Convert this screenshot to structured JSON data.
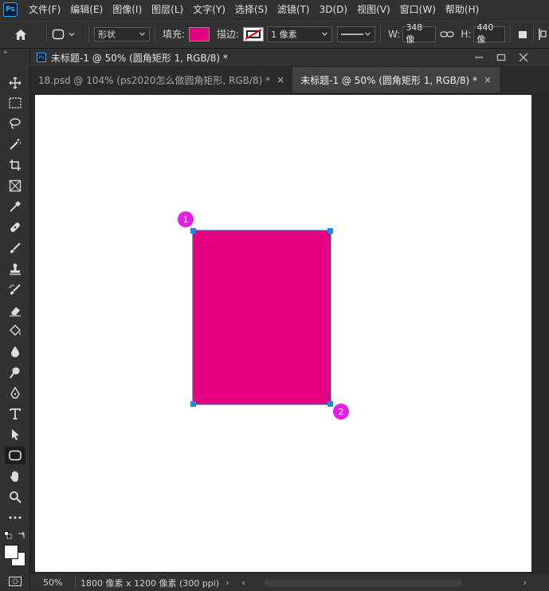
{
  "app": {
    "logo": "Ps"
  },
  "menu": [
    "文件(F)",
    "编辑(E)",
    "图像(I)",
    "图层(L)",
    "文字(Y)",
    "选择(S)",
    "滤镜(T)",
    "3D(D)",
    "视图(V)",
    "窗口(W)",
    "帮助(H)"
  ],
  "options": {
    "mode": "形状",
    "fill_label": "填充:",
    "stroke_label": "描边:",
    "stroke_width": "1 像素",
    "w_label": "W:",
    "w_value": "348 像",
    "h_label": "H:",
    "h_value": "440 像",
    "fill_color": "#e4007f"
  },
  "document": {
    "window_title": "未标题-1 @ 50% (圆角矩形 1, RGB/8) *",
    "tabs": [
      {
        "label": "18.psd @ 104% (ps2020怎么做圆角矩形, RGB/8) *",
        "active": false
      },
      {
        "label": "未标题-1 @ 50% (圆角矩形 1, RGB/8) *",
        "active": true
      }
    ]
  },
  "shape": {
    "color": "#e4007f",
    "handle_color": "#1e88e5",
    "marker_color": "#e91ee6"
  },
  "markers": [
    "1",
    "2"
  ],
  "status": {
    "zoom": "50%",
    "doc_info": "1800 像素 x 1200 像素 (300 ppi)"
  }
}
